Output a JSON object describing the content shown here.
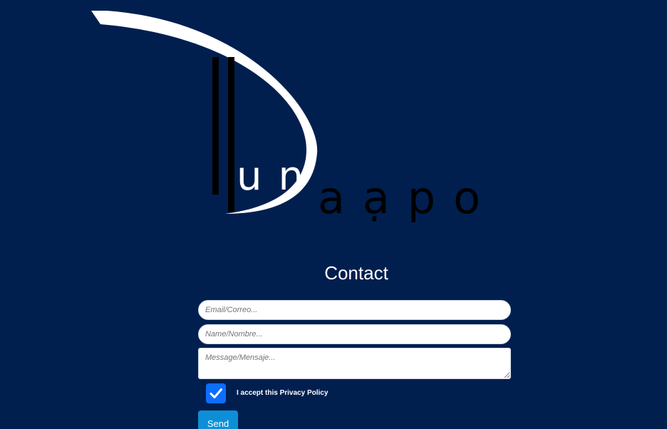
{
  "brand": {
    "logo_text_light": "un",
    "logo_text_dark": "aạpo"
  },
  "contact": {
    "title": "Contact",
    "email_placeholder": "Email/Correo...",
    "name_placeholder": "Name/Nombre...",
    "message_placeholder": "Message/Mensaje...",
    "privacy_label": "I accept this Privacy Policy",
    "privacy_checked": true,
    "send_label": "Send"
  },
  "colors": {
    "background": "#001f4f",
    "checkbox": "#0d6efd",
    "send_button": "#0d8fd8"
  }
}
